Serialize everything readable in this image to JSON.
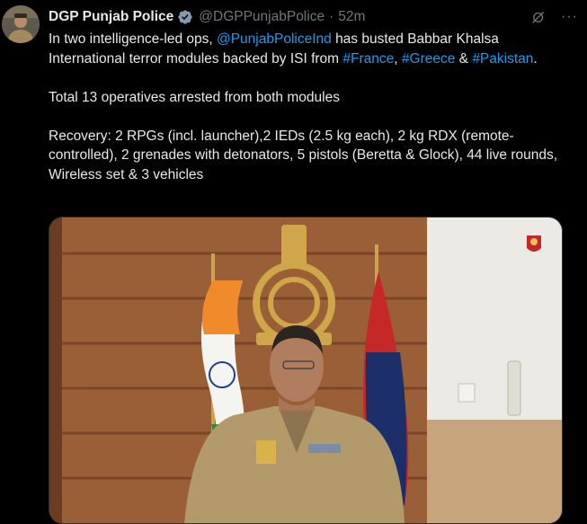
{
  "tweet": {
    "author_name": "DGP Punjab Police",
    "handle": "@DGPPunjabPolice",
    "separator": "·",
    "time": "52m",
    "more_label": "···",
    "text": {
      "intro_1": "In two intelligence-led ops,",
      "mention": "@PunjabPoliceInd",
      "intro_2": "has busted Babbar Khalsa International terror modules backed by ISI from",
      "tag_france": "#France",
      "comma": ",",
      "tag_greece": "#Greece",
      "amp": "&",
      "tag_pakistan": "#Pakistan",
      "period": ".",
      "line_2": "Total 13 operatives arrested from both modules",
      "line_3": "Recovery: 2 RPGs (incl. launcher),2 IEDs (2.5 kg each), 2 kg RDX (remote-controlled), 2 grenades with detonators, 5 pistols (Beretta & Glock), 44 live rounds, Wireless set & 3 vehicles"
    }
  },
  "icons": {
    "verified": "verified-badge-icon",
    "grok": "grok-icon",
    "more": "more-options-icon"
  },
  "colors": {
    "background": "#000000",
    "text": "#e7e9ea",
    "secondary": "#71767b",
    "link": "#1d9bf0",
    "verified": "#829aab"
  }
}
